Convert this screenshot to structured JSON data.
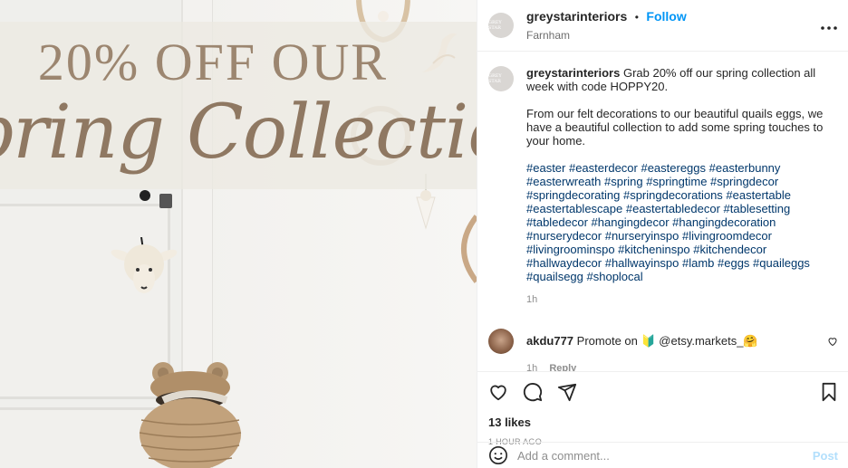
{
  "post": {
    "image": {
      "headline": "20% OFF OUR",
      "script_text": "Spring Collection"
    },
    "header": {
      "username": "greystarinteriors",
      "separator": "•",
      "follow_label": "Follow",
      "location": "Farnham",
      "more_icon": "more-horizontal-icon"
    },
    "caption": {
      "username": "greystarinteriors",
      "text": "Grab 20% off our spring collection all week with code HOPPY20.",
      "paragraph2": "From our felt decorations to our beautiful quails eggs, we have a beautiful collection to add some spring touches to your home.",
      "hashtags": "#easter #easterdecor #eastereggs #easterbunny #easterwreath #spring #springtime #springdecor #springdecorating #springdecorations #eastertable #eastertablescape #eastertabledecor #tablesetting #tabledecor #hangingdecor #hangingdecoration #nurserydecor #nurseryinspo #livingroomdecor #livingroominspo #kitcheninspo #kitchendecor #hallwaydecor #hallwayinspo #lamb #eggs #quaileggs #quailsegg #shoplocal",
      "time": "1h"
    },
    "comments": [
      {
        "username": "akdu777",
        "text": "Promote on 🔰 @etsy.markets_🤗",
        "time": "1h",
        "reply_label": "Reply"
      }
    ],
    "likes": "13 likes",
    "posted_ago": "1 HOUR AGO",
    "add_comment": {
      "placeholder": "Add a comment...",
      "post_label": "Post"
    }
  }
}
